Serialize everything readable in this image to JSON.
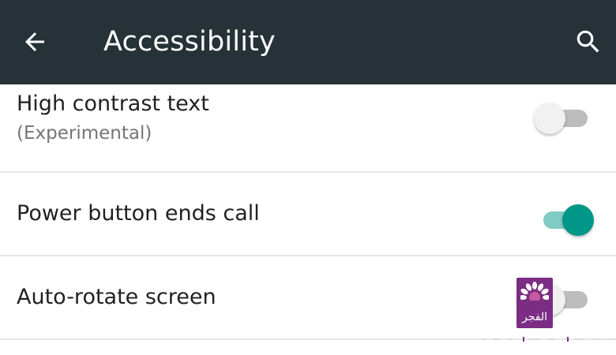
{
  "appbar": {
    "title": "Accessibility",
    "back_icon": "arrow-back-icon",
    "search_icon": "search-icon",
    "background": "#263238"
  },
  "settings": [
    {
      "title": "High contrast text",
      "summary": "(Experimental)",
      "enabled": false
    },
    {
      "title": "Power button ends call",
      "enabled": true
    },
    {
      "title": "Auto-rotate screen",
      "enabled": false
    }
  ],
  "colors": {
    "accent": "#009688",
    "accent_track": "#80cbc4",
    "text_primary": "#212121",
    "text_secondary": "#757575"
  },
  "watermark": {
    "text": "الفجر",
    "color": "#7b2d84"
  }
}
